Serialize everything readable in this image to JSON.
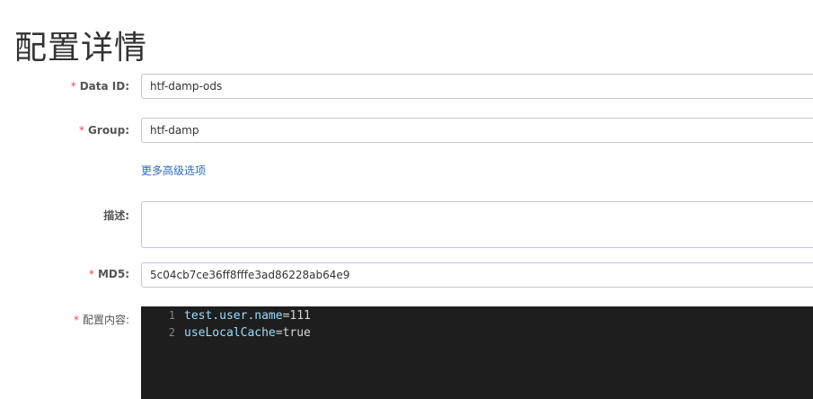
{
  "page": {
    "title": "配置详情"
  },
  "form": {
    "required_mark": "*",
    "data_id": {
      "label": "Data ID:",
      "value": "htf-damp-ods"
    },
    "group": {
      "label": "Group:",
      "value": "htf-damp"
    },
    "advanced_link": "更多高级选项",
    "description": {
      "label": "描述:",
      "value": ""
    },
    "md5": {
      "label": "MD5:",
      "value": "5c04cb7ce36ff8fffe3ad86228ab64e9"
    },
    "content": {
      "label": "配置内容:",
      "lines": [
        {
          "number": "1",
          "key": "test.user.name",
          "eq": "=",
          "value": "111"
        },
        {
          "number": "2",
          "key": "useLocalCache",
          "eq": "=",
          "value": "true"
        }
      ]
    }
  },
  "colors": {
    "required": "#e5484d",
    "link": "#2a6ebb",
    "editor_bg": "#1e1e1e",
    "code_key": "#9cdcfe",
    "code_value": "#d4d4d4"
  }
}
